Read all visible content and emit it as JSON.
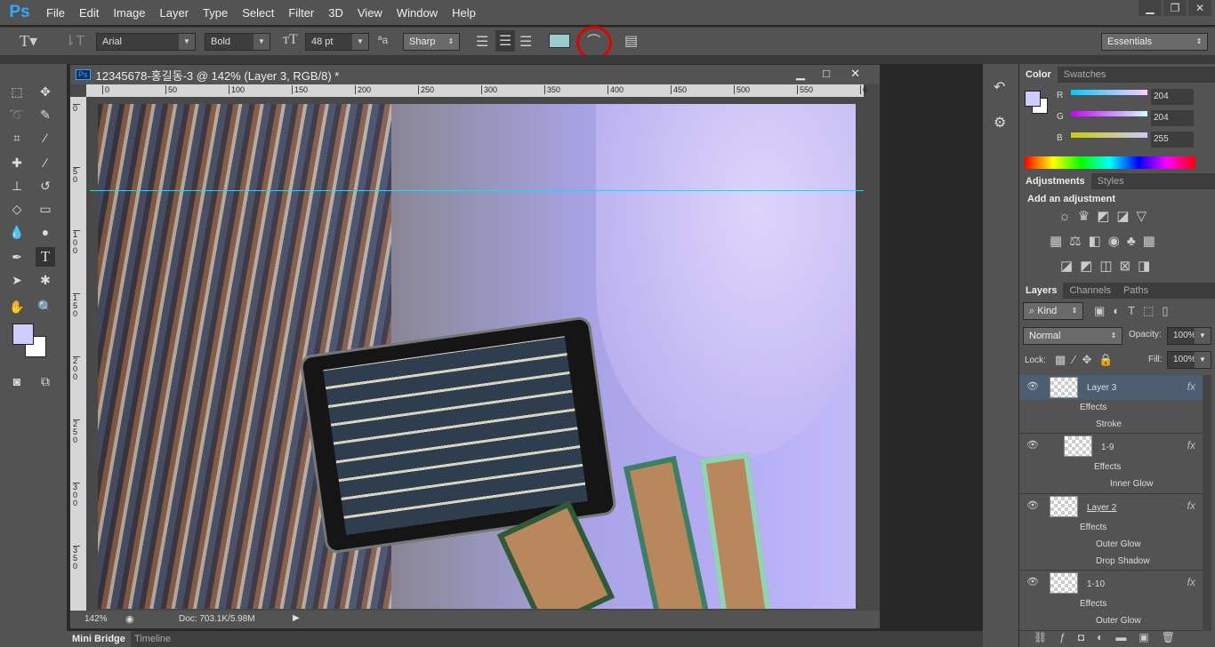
{
  "app": {
    "logo": "Ps",
    "menus": [
      "File",
      "Edit",
      "Image",
      "Layer",
      "Type",
      "Select",
      "Filter",
      "3D",
      "View",
      "Window",
      "Help"
    ],
    "window_controls": [
      "minimize",
      "restore",
      "close"
    ]
  },
  "options": {
    "font_family": "Arial",
    "font_style": "Bold",
    "font_size": "48 pt",
    "antialias": "Sharp",
    "text_color": "#99cccc",
    "workspace": "Essentials",
    "highlighted_tool": "warp-text-icon",
    "highlight_color": "#e00000"
  },
  "document": {
    "title": "12345678-홍길동-3 @ 142% (Layer 3, RGB/8) *",
    "ruler_h": [
      "0",
      "50",
      "100",
      "150",
      "200",
      "250",
      "300",
      "350",
      "400",
      "450",
      "500",
      "550",
      "6"
    ],
    "ruler_v": [
      "0",
      "5 0",
      "1 0 0",
      "1 5 0",
      "2 0 0",
      "2 5 0",
      "3 0 0",
      "3 5 0"
    ],
    "zoom": "142%",
    "doc_info": "Doc: 703.1K/5.98M",
    "guide_color": "#00e5ff"
  },
  "bottom_tabs": [
    "Mini Bridge",
    "Timeline"
  ],
  "color_panel": {
    "tabs": [
      "Color",
      "Swatches"
    ],
    "r_label": "R",
    "g_label": "G",
    "b_label": "B",
    "r": "204",
    "g": "204",
    "b": "255",
    "foreground": "#ccccff"
  },
  "adjustments": {
    "tabs": [
      "Adjustments",
      "Styles"
    ],
    "heading": "Add an adjustment"
  },
  "layers": {
    "tabs": [
      "Layers",
      "Channels",
      "Paths"
    ],
    "filter": "Kind",
    "blend_mode": "Normal",
    "opacity_label": "Opacity:",
    "opacity": "100%",
    "lock_label": "Lock:",
    "fill_label": "Fill:",
    "fill": "100%",
    "items": [
      {
        "name": "Layer 3",
        "effects_label": "Effects",
        "effects": [
          "Stroke"
        ],
        "selected": true
      },
      {
        "name": "1-9",
        "effects_label": "Effects",
        "effects": [
          "Inner Glow"
        ],
        "selected": false
      },
      {
        "name": "Layer 2",
        "effects_label": "Effects",
        "effects": [
          "Outer Glow",
          "Drop Shadow"
        ],
        "selected": false
      },
      {
        "name": "1-10",
        "effects_label": "Effects",
        "effects": [
          "Outer Glow"
        ],
        "selected": false
      }
    ],
    "fx": "fx"
  }
}
